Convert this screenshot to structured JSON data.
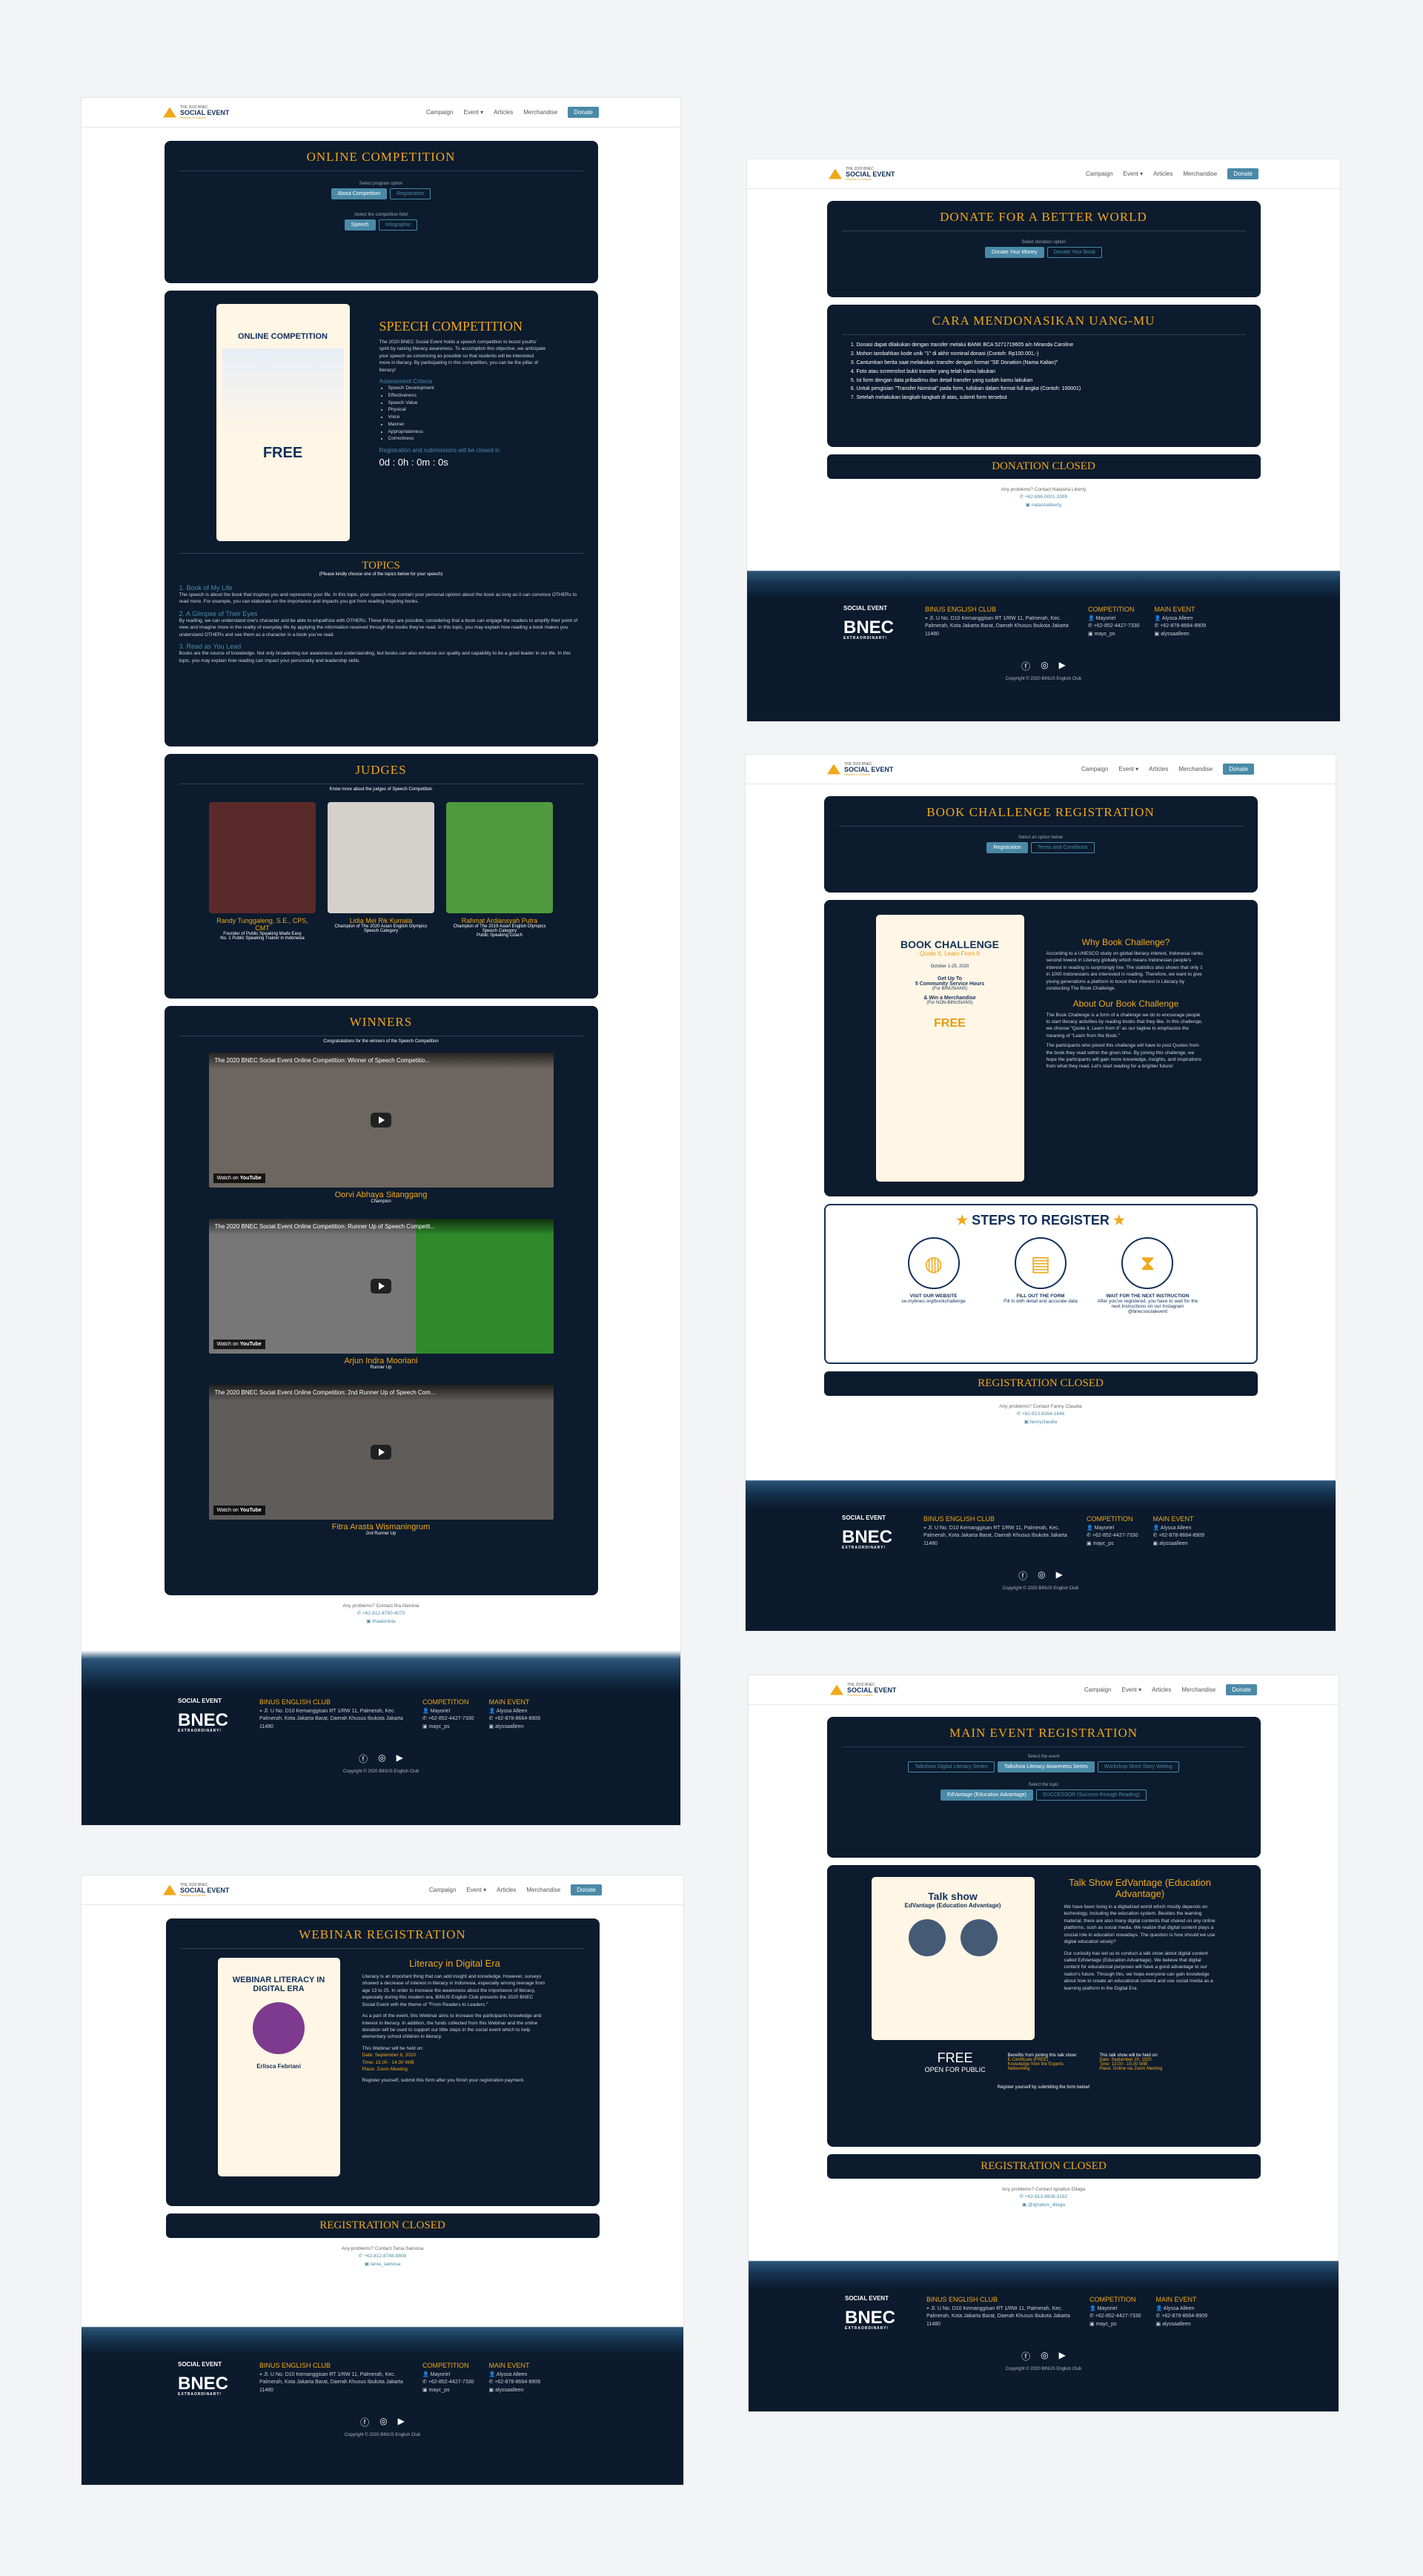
{
  "nav": {
    "brand_small": "THE 2020 BNEC",
    "brand_main": "SOCIAL EVENT",
    "brand_tag": "Readers to Leaders",
    "items": [
      "Campaign",
      "Event",
      "Articles",
      "Merchandise"
    ],
    "donate": "Donate"
  },
  "footer": {
    "social_event": "SOCIAL EVENT",
    "bnec": "BNEC",
    "bnec_sub": "EXTRAORDINARY!",
    "club_title": "BINUS ENGLISH CLUB",
    "address": "Jl. U No. D10 Kemanggisan RT 1/RW 11, Palmerah, Kec. Palmerah, Kota Jakarta Barat, Daerah Khusus Ibukota Jakarta 11480",
    "competition_title": "COMPETITION",
    "main_event_title": "MAIN EVENT",
    "comp_contacts": [
      "Mayoriel",
      "+62-852-4427-7330",
      "mayc_ps"
    ],
    "main_contacts": [
      "Alyssa Alleen",
      "+62-878-8664-8909",
      "alyssaalleen"
    ],
    "copyright": "Copyright © 2020 BINUS English Club"
  },
  "online_comp": {
    "title": "ONLINE COMPETITION",
    "select_session": "Select program option",
    "session_btns": [
      "About Competition",
      "Registration"
    ],
    "select_field": "Select the competition field",
    "field_btns": [
      "Speech",
      "Infographic"
    ],
    "poster_title": "ONLINE COMPETITION",
    "poster_free": "FREE",
    "speech_title": "SPEECH COMPETITION",
    "speech_text": "The 2020 BNEC Social Event holds a speech competition to boost youths' spirit by raising literacy awareness. To accomplish this objective, we anticipate your speech as convincing as possible so that students will be interested more in literacy. By participating in this competition, you can be the pillar of literacy!",
    "criteria_title": "Assessment Criteria",
    "criteria": [
      "Speech Development",
      "Effectiveness",
      "Speech Value",
      "Physical",
      "Voice",
      "Manner",
      "Appropriateness",
      "Correctness"
    ],
    "deadline_text": "Registration and submissions will be closed in",
    "countdown": "0d : 0h : 0m : 0s",
    "topics_title": "TOPICS",
    "topics_sub": "(Please kindly choose one of the topics below for your speech)",
    "topics": [
      {
        "n": "1.",
        "t": "Book of My Life",
        "d": "The speech is about the book that inspires you and represents your life. In this topic, your speech may contain your personal opinion about the book as long as it can convince OTHERs to read more. For example, you can elaborate on the importance and impacts you got from reading inspiring books."
      },
      {
        "n": "2.",
        "t": "A Glimpse of Their Eyes",
        "d": "By reading, we can understand one's character and be able to empathize with OTHERs. These things are possible, considering that a book can engage the readers to amplify their point of view and imagine more in the reality of everyday life by applying the information received through the books they've read. In this topic, you may explain how reading a book makes you understand OTHERs and see them as a character in a book you've read."
      },
      {
        "n": "3.",
        "t": "Read as You Lead",
        "d": "Books are the source of knowledge. Not only broadening our awareness and understanding, but books can also enhance our quality and capability to be a good leader in our life. In this topic, you may explain how reading can impact your personality and leadership skills."
      }
    ],
    "judges_title": "JUDGES",
    "judges_sub": "Know more about the judges of Speech Competition",
    "judges": [
      {
        "name": "Randy Tunggaleng, S.E., CPS, CMT",
        "d1": "Founder of Public Speaking Made Easy",
        "d2": "No. 1 Public Speaking Trainer in Indonesia",
        "color": "#5a2a2a"
      },
      {
        "name": "Lidia Mei Rik Kumala",
        "d1": "Champion of The 2020 Asian English Olympics Speech Category",
        "d2": "",
        "color": "#d4d0cc"
      },
      {
        "name": "Rahmat Ardiansyah Putra",
        "d1": "Champion of The 2019 Asian English Olympics Speech Category",
        "d2": "Public Speaking Coach",
        "color": "#4f9a3f"
      }
    ],
    "winners_title": "WINNERS",
    "winners_sub": "Congratulations for the winners of the Speech Competition",
    "winners": [
      {
        "video": "The 2020 BNEC Social Event Online Competition: Winner of Speech Competitio...",
        "name": "Oorvi Abhaya Sitanggang",
        "rank": "Champion"
      },
      {
        "video": "The 2020 BNEC Social Event Online Competition: Runner Up of Speech Competit...",
        "name": "Arjun Indra Mooriani",
        "rank": "Runner Up"
      },
      {
        "video": "The 2020 BNEC Social Event Online Competition: 2nd Runner Up of Speech Com...",
        "name": "Fitra Arasta Wismaningrum",
        "rank": "2nd Runner Up"
      }
    ],
    "watch_on": "Watch on",
    "yt": "YouTube",
    "share": "Share",
    "contact": "Any problems? Contact Ifra Alenloia",
    "contact_phone": "+62-812-8790-4070",
    "contact_line": "ifraalenloia"
  },
  "donate": {
    "title": "DONATE FOR A BETTER WORLD",
    "select": "Select donation option",
    "btns": [
      "Donate Your Money",
      "Donate Your Book"
    ],
    "how_title": "CARA MENDONASIKAN UANG-MU",
    "steps": [
      "Donasi dapat dilakukan dengan transfer melalui BANK BCA 5271719605 a/n Miranda Caroline",
      "Mohon tambahkan kode unik \"1\" di akhir nominal donasi (Contoh: Rp100.001,-)",
      "Cantumkan berita saat melakukan transfer dengan format \"SE Donation (Nama Kalian)\"",
      "Foto atau screenshot bukti transfer yang telah kamu lakukan",
      "Isi form dengan data pribadimu dan detail transfer yang sudah kamu lakukan",
      "Untuk pengisian \"Transfer Nominal\" pada form, tuliskan dalam format full angka (Contoh: 100001)",
      "Setelah melakukan langkah-langkah di atas, submit form tersebut"
    ],
    "closed": "DONATION CLOSED",
    "contact": "Any problems? Contact Natasha Liberty",
    "contact_phone": "+62-896-0001-3399",
    "contact_line": "natashaliberty"
  },
  "book": {
    "title": "BOOK CHALLENGE REGISTRATION",
    "select": "Select an option below",
    "btns": [
      "Registration",
      "Terms and Conditions"
    ],
    "poster_title": "BOOK CHALLENGE",
    "poster_sub": "Quote It, Learn From It",
    "poster_date": "October 1-25, 2020",
    "poster_line1": "Get Up To",
    "poster_line2": "5 Community Service Hours",
    "poster_line3": "(For BINUSIANS)",
    "poster_line4": "& Win a Merchandise",
    "poster_line5": "(For NON-BINUSIANS)",
    "poster_free": "FREE",
    "why_title": "Why Book Challenge?",
    "why_text": "According to a UNESCO study on global literacy interest, Indonesia ranks second lowest in Literacy globally which means Indonesian people's interest in reading is surprisingly low. The statistics also shows that only 1 in 1000 Indonesians are interested in reading. Therefore, we want to give young generations a platform to boost their interest in Literacy by conducting The Book Challenge.",
    "about_title": "About Our Book Challenge",
    "about_text": "The Book Challenge is a form of a challenge we do to encourage people to start literacy activities by reading books that they like. In this challenge, we choose \"Quote it, Learn from it\" as our tagline to emphasize the meaning of \"Learn from the Book.\"",
    "about_text2": "The participants who joined this challenge will have to post Quotes from the book they read within the given time. By joining this challenge, we hope the participants will gain more knowledge, insights, and inspirations from what they read. Let's start reading for a brighter future!",
    "steps_title": "STEPS TO REGISTER",
    "steps": [
      {
        "t": "VISIT OUR WEBSITE",
        "d": "se.mybnec.org/bookchallenge"
      },
      {
        "t": "FILL OUT THE FORM",
        "d": "Fill in with detail and accurate data"
      },
      {
        "t": "WAIT FOR THE NEXT INSTRUCTION",
        "d": "After you've registered, you have to wait for the next instructions on our Instagram @bnecsocialevent"
      }
    ],
    "closed": "REGISTRATION CLOSED",
    "contact": "Any problems? Contact Fanny Claudia",
    "contact_phone": "+62-813-8364-1646",
    "contact_line": "fannyclaudia"
  },
  "webinar": {
    "title": "WEBINAR REGISTRATION",
    "poster_title": "WEBINAR LITERACY IN DIGITAL ERA",
    "poster_name": "Erlisca Febriani",
    "subtitle": "Literacy in Digital Era",
    "text1": "Literacy is an important thing that can add insight and knowledge. However, surveys showed a decrease of interest in literacy in Indonesia, especially among teenage from age 13 to 25. In order to increase the awareness about the importance of literacy, especially during this modern era, BINUS English Club presents the 2020 BNEC Social Event with the theme of \"From Readers to Leaders.\"",
    "text2": "As a part of the event, this Webinar aims to increase the participants knowledge and interest in literacy. In addition, the funds collected from this Webinar and the online donation will be used to support our little steps in the social event which to help elementary school children in literacy.",
    "held": "This Webinar will be held on:",
    "date": "Date: September 6, 2020",
    "time": "Time: 13.00 - 14.30 WIB",
    "place": "Place: Zoom Meeting",
    "register": "Register yourself, submit this form after you finish your registration payment.",
    "closed": "REGISTRATION CLOSED",
    "contact": "Any problems? Contact Tania Samosa",
    "contact_phone": "+62-812-8748-8808",
    "contact_line": "tania_samosa"
  },
  "main": {
    "title": "MAIN EVENT REGISTRATION",
    "select_series": "Select the event",
    "series_btns": [
      "Talkshow Digital Literacy Series",
      "Talkshow Literacy Awareness Series",
      "Workshop Short Story Writing"
    ],
    "select_topic": "Select the topic",
    "topic_btns": [
      "EdVantage (Education Advantage)",
      "SUCCESSOR (Success through Reading)"
    ],
    "poster_title": "Talk show",
    "poster_sub": "EdVantage (Education Advantage)",
    "show_title": "Talk Show EdVantage (Education Advantage)",
    "text1": "We have been living in a digitalized world which mostly depends on technology, including the education system. Besides the learning material, there are also many digital contents that shared on any online platforms, such as social media. We realize that digital content plays a crucial role in education nowadays. The question is how should we use digital education wisely?",
    "text2": "Our curiosity has led us to conduct a talk show about digital content called EdVantage (Education Advantage). We believe that digital content for educational purposes will have a good advantage to our nation's future. Through this, we hope everyone can gain knowledge about how to create an educational content and use social media as a learning platform in the Digital Era.",
    "free": "FREE",
    "open": "OPEN FOR PUBLIC",
    "benefits_title": "Benefits from joining this talk show:",
    "benefits": [
      "E-Certificate (FREE)",
      "Knowledge from the Experts",
      "Networking"
    ],
    "held_title": "This talk show will be held on:",
    "held": [
      "Date: September 20, 2020",
      "Time: 13.00 - 15.00 WIB",
      "Place: Online via Zoom Meeting"
    ],
    "register": "Register yourself by submitting the form below!",
    "closed": "REGISTRATION CLOSED",
    "contact": "Any problems? Contact Ignatius Dilaga",
    "contact_phone": "+62-813-9836-3182",
    "contact_line": "@ignatius_dilaga"
  }
}
